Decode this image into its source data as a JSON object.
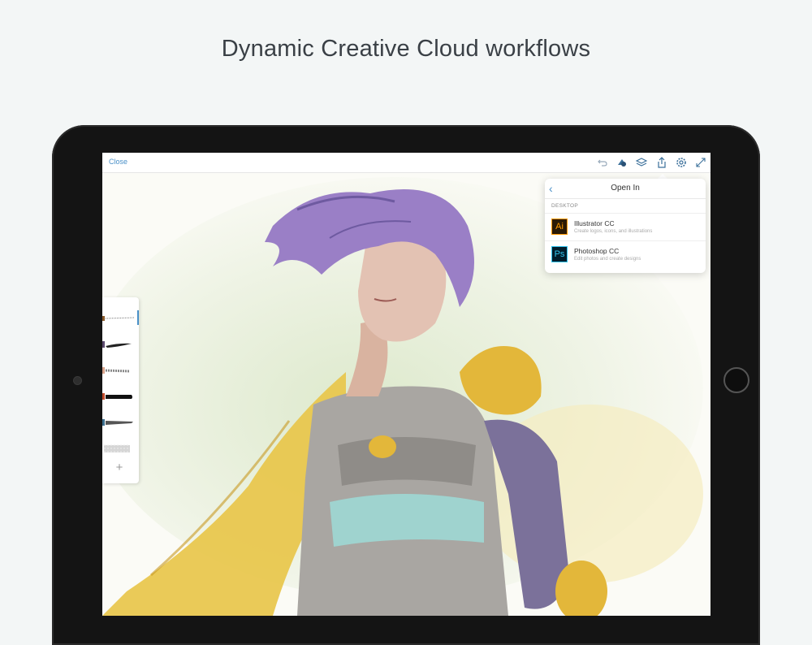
{
  "headline": "Dynamic Creative Cloud workflows",
  "toolbar": {
    "close_label": "Close",
    "icons": [
      "undo-icon",
      "shapes-icon",
      "layers-icon",
      "share-icon",
      "settings-icon",
      "fullscreen-icon"
    ]
  },
  "open_in": {
    "title": "Open In",
    "section": "DESKTOP",
    "items": [
      {
        "icon_text": "Ai",
        "name": "Illustrator CC",
        "description": "Create logos, icons, and illustrations",
        "color": "#ff9a00"
      },
      {
        "icon_text": "Ps",
        "name": "Photoshop CC",
        "description": "Edit photos and create designs",
        "color": "#31c5f0"
      }
    ]
  },
  "brushes": {
    "add_label": "+",
    "colors": [
      "#8a5a2b",
      "#5b4a6e",
      "#d9a48c",
      "#c24a2a",
      "#3b6f8f",
      "#bbbbbb"
    ]
  },
  "colors": {
    "accent": "#4a90c8",
    "hair": "#9a7fc6",
    "armor_gold": "#e3b73a",
    "cape": "#e8c64a",
    "armor_steel": "#9b9a96"
  }
}
